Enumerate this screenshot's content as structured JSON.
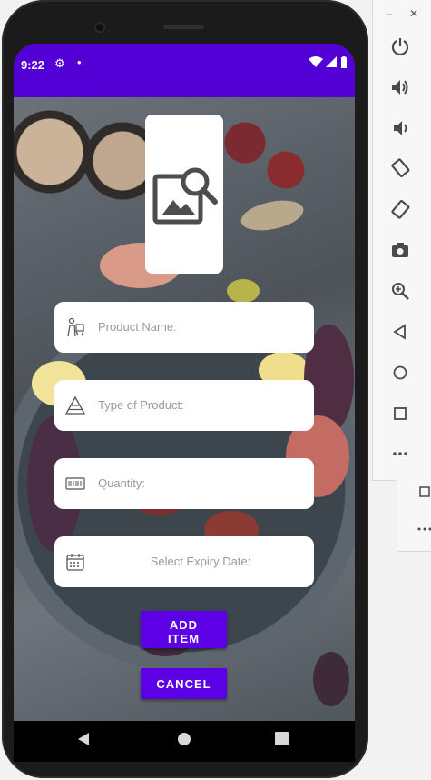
{
  "status_bar": {
    "time": "9:22"
  },
  "form": {
    "product_name_placeholder": "Product Name:",
    "type_placeholder": "Type of Product:",
    "quantity_placeholder": "Quantity:",
    "expiry_label": "Select Expiry Date:"
  },
  "buttons": {
    "add_line1": "ADD",
    "add_line2": "ITEM",
    "cancel": "CANCEL"
  },
  "colors": {
    "status_bar": "#5200d6",
    "button": "#5c00e6"
  },
  "icons": {
    "image_picker": "image-search-icon",
    "product_name": "shopping-person-icon",
    "type": "pyramid-icon",
    "quantity": "barcode-icon",
    "expiry": "calendar-icon"
  },
  "emulator_panel": {
    "window_controls": [
      "–",
      "✕"
    ],
    "tools": [
      "power",
      "volume-up",
      "volume-down",
      "rotate-left",
      "rotate-right",
      "camera",
      "zoom",
      "back",
      "home",
      "overview",
      "more"
    ]
  }
}
